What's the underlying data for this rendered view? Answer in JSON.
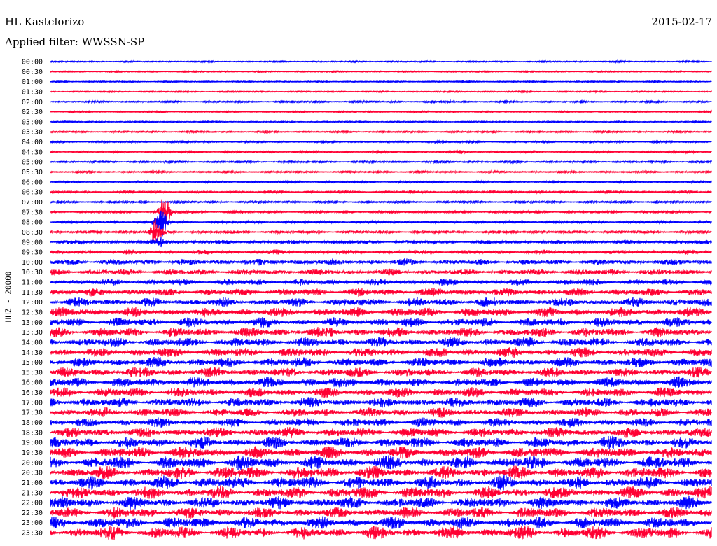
{
  "header": {
    "station": "HL Kastelorizo",
    "date": "2015-02-17",
    "filter": "Applied filter: WWSSN-SP"
  },
  "chart_data": {
    "type": "line",
    "title": "HL Kastelorizo helicorder 2015-02-17",
    "ylabel": "HHZ - 20000",
    "row_minutes": 30,
    "colors": [
      "#0000ff",
      "#ff0033"
    ],
    "tick_labels": [
      "00:00",
      "00:30",
      "01:00",
      "01:30",
      "02:00",
      "02:30",
      "03:00",
      "03:30",
      "04:00",
      "04:30",
      "05:00",
      "05:30",
      "06:00",
      "06:30",
      "07:00",
      "07:30",
      "08:00",
      "08:30",
      "09:00",
      "09:30",
      "10:00",
      "10:30",
      "11:00",
      "11:30",
      "12:00",
      "12:30",
      "13:00",
      "13:30",
      "14:00",
      "14:30",
      "15:00",
      "15:30",
      "16:00",
      "16:30",
      "17:00",
      "17:30",
      "18:00",
      "18:30",
      "19:00",
      "19:30",
      "20:00",
      "20:30",
      "21:00",
      "21:30",
      "22:00",
      "22:30",
      "23:00",
      "23:30"
    ],
    "noise_amplitude": [
      0.4,
      0.4,
      0.4,
      0.4,
      0.6,
      0.5,
      0.4,
      0.6,
      0.6,
      0.7,
      0.7,
      0.7,
      0.7,
      0.8,
      0.9,
      1.0,
      1.3,
      1.6,
      2.2,
      2.6,
      3.4,
      3.6,
      4.0,
      4.4,
      5.0,
      5.2,
      5.4,
      5.6,
      5.6,
      5.4,
      5.6,
      5.6,
      5.8,
      5.8,
      5.6,
      5.4,
      5.2,
      5.8,
      6.4,
      7.0,
      7.4,
      7.4,
      7.2,
      7.0,
      6.8,
      6.6,
      6.8,
      7.2
    ],
    "events": [
      {
        "row": "02:00",
        "minute": 18.0,
        "amplitude": 2
      },
      {
        "row": "04:00",
        "minute": 17.5,
        "amplitude": 2
      },
      {
        "row": "04:30",
        "minute": 18.7,
        "amplitude": 3
      },
      {
        "row": "04:30",
        "minute": 29.0,
        "amplitude": 3
      },
      {
        "row": "06:30",
        "minute": 21.0,
        "amplitude": 2
      },
      {
        "row": "07:30",
        "minute": 5.2,
        "amplitude": 30
      },
      {
        "row": "08:00",
        "minute": 5.0,
        "amplitude": 28
      },
      {
        "row": "08:30",
        "minute": 4.8,
        "amplitude": 20
      },
      {
        "row": "09:00",
        "minute": 5.0,
        "amplitude": 10
      }
    ]
  }
}
